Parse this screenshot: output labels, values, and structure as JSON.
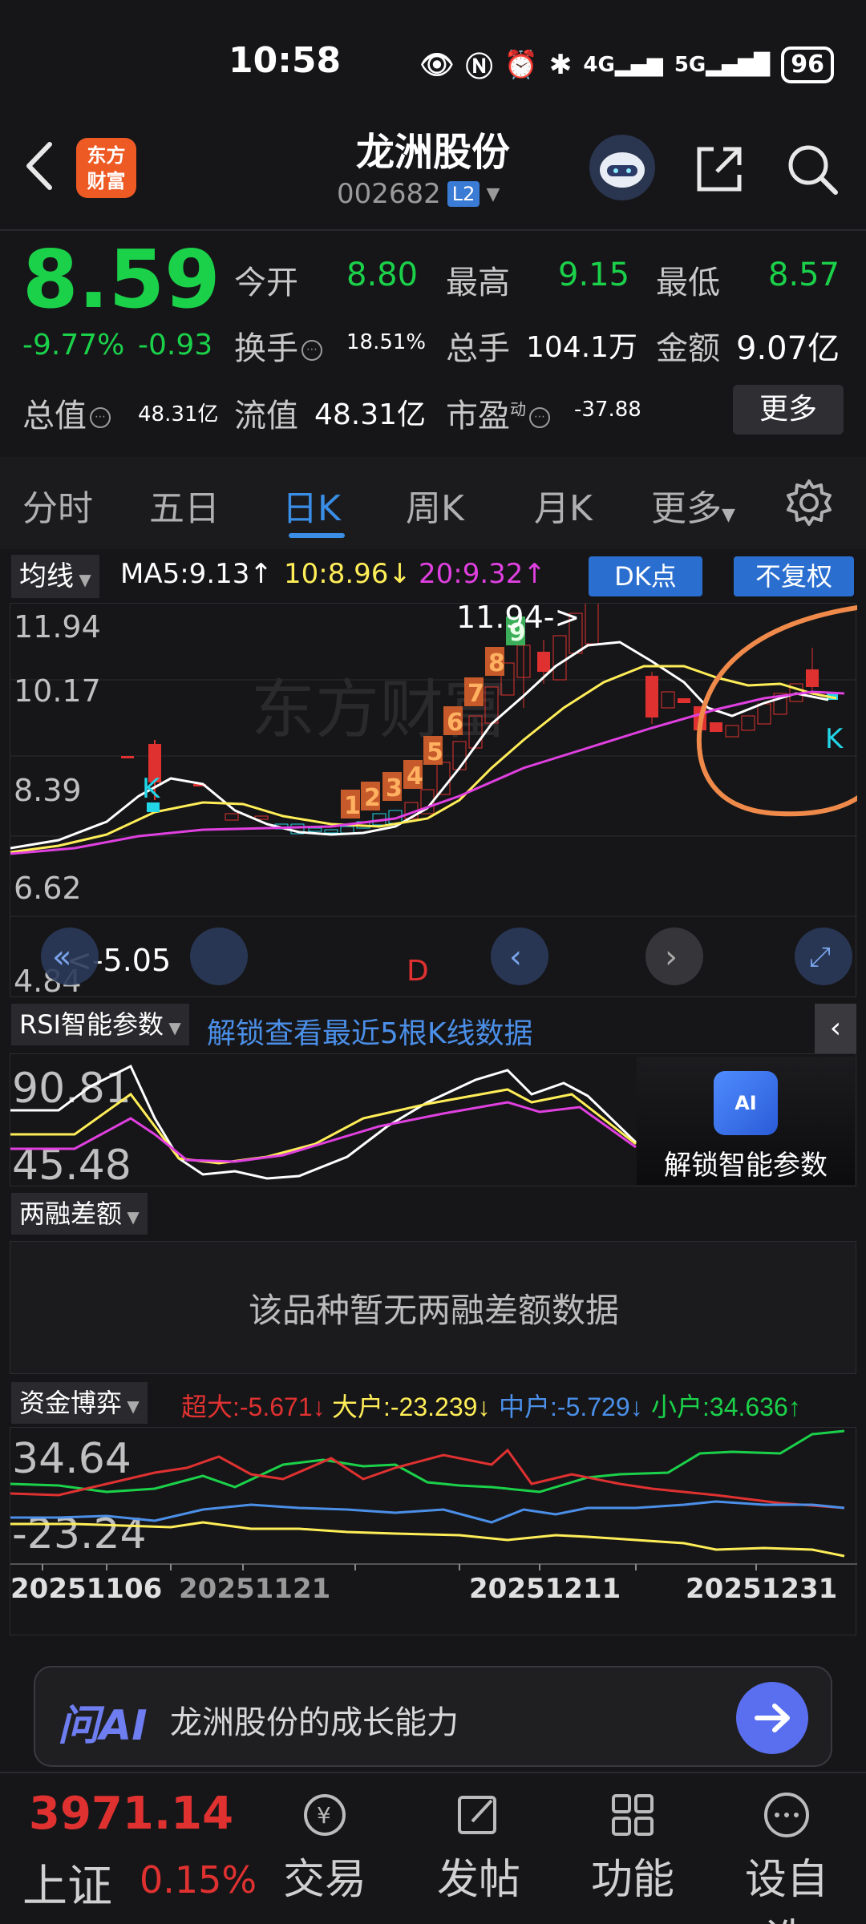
{
  "status_bar": {
    "time": "10:58",
    "battery": "96",
    "network_icons": [
      "eye-icon",
      "nfc-icon",
      "alarm-icon",
      "bluetooth-icon",
      "4g-signal-icon",
      "5g-signal-icon"
    ]
  },
  "header": {
    "logo_line1": "东方",
    "logo_line2": "财富",
    "stock_name": "龙洲股份",
    "stock_code": "002682",
    "level_badge": "L2"
  },
  "quote": {
    "price": "8.59",
    "change_pct": "-9.77%",
    "change": "-0.93",
    "open_label": "今开",
    "open": "8.80",
    "high_label": "最高",
    "high": "9.15",
    "low_label": "最低",
    "low": "8.57",
    "turnover_label": "换手",
    "turnover": "18.51%",
    "volume_label": "总手",
    "volume": "104.1万",
    "amount_label": "金额",
    "amount": "9.07亿",
    "mktcap_label": "总值",
    "mktcap": "48.31亿",
    "float_label": "流值",
    "float": "48.31亿",
    "pe_label": "市盈",
    "pe_sup": "动",
    "pe": "-37.88",
    "more_label": "更多"
  },
  "tabs": [
    "分时",
    "五日",
    "日K",
    "周K",
    "月K",
    "更多"
  ],
  "active_tab": "日K",
  "ma": {
    "selector": "均线",
    "ma5": "MA5:9.13↑",
    "ma10": "10:8.96↓",
    "ma20": "20:9.32↑",
    "dk_label": "DK点",
    "adjust_label": "不复权"
  },
  "kline": {
    "price_ticks": [
      "11.94",
      "10.17",
      "8.39",
      "6.62",
      "4.84"
    ],
    "high_marker": "11.94->",
    "low_marker": "<-5.05",
    "signal_up": "K",
    "signal_down": "D",
    "seq_numbers": [
      "1",
      "2",
      "3",
      "4",
      "5",
      "6",
      "7",
      "8",
      "9"
    ],
    "watermark": "东方财富"
  },
  "rsi": {
    "selector": "RSI智能参数",
    "unlock_text": "解锁查看最近5根K线数据",
    "ticks": [
      "90.81",
      "45.48"
    ],
    "card_badge": "AI",
    "card_label": "解锁智能参数"
  },
  "margin": {
    "selector": "两融差额",
    "empty_text": "该品种暂无两融差额数据"
  },
  "fund": {
    "selector": "资金博弈",
    "super": "超大:-5.671↓",
    "large": "大户:-23.239↓",
    "medium": "中户:-5.729↓",
    "small": "小户:34.636↑",
    "ticks": [
      "34.64",
      "-23.24"
    ],
    "dates": [
      "20251106",
      "20251121",
      "20251211",
      "20251231"
    ]
  },
  "ask": {
    "label": "问AI",
    "text": "龙洲股份的成长能力"
  },
  "bottom_nav": {
    "index_value": "3971.14",
    "index_name": "上证",
    "index_pct": "0.15%",
    "items": [
      "交易",
      "发帖",
      "功能",
      "设自选"
    ]
  },
  "colors": {
    "down_green": "#1bd14a",
    "up_red": "#e03131",
    "accent_blue": "#3a8ee6",
    "ma5_white": "#ffffff",
    "ma10_yellow": "#ffee58",
    "ma20_magenta": "#e040e0"
  }
}
